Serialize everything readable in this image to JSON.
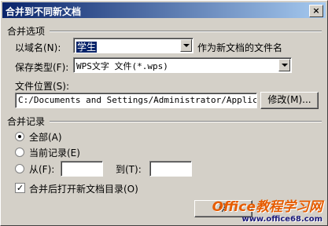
{
  "window": {
    "title": "合并到不同新文档",
    "close_glyph": "×"
  },
  "merge_options": {
    "group_title": "合并选项",
    "domain_label": "以域名(N):",
    "domain_value": "学生",
    "domain_hint": "作为新文档的文件名",
    "save_type_label": "保存类型(F):",
    "save_type_value": "WPS文字 文件(*.wps)",
    "location_label": "文件位置(S):",
    "location_value": "C:/Documents and Settings/Administrator/Applicatio",
    "modify_button": "修改(M)..."
  },
  "merge_records": {
    "group_title": "合并记录",
    "all_label": "全部(A)",
    "current_label": "当前记录(E)",
    "from_label": "从(F):",
    "to_label": "到(T):",
    "from_value": "",
    "to_value": "",
    "selected": "all"
  },
  "open_after": {
    "label": "合并后打开新文档目录(O)",
    "checked": true,
    "check_glyph": "✓"
  },
  "ok_button": "确",
  "watermark": {
    "text": "Office教程学习网",
    "url": "www.office68.com"
  }
}
